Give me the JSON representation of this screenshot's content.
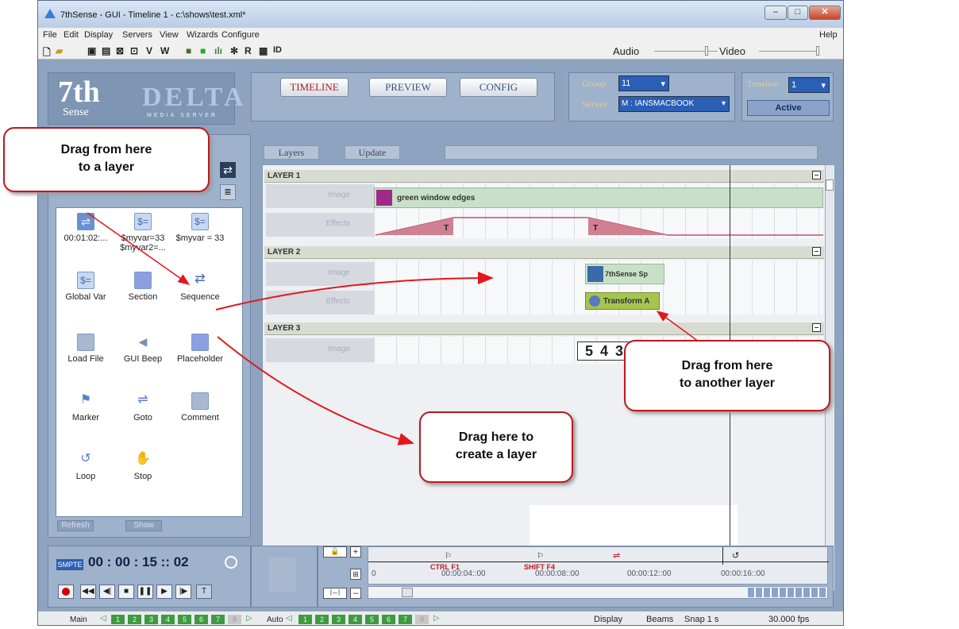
{
  "window": {
    "title": "7thSense -  GUI - Timeline 1 - c:\\shows\\test.xml*"
  },
  "menu": {
    "items": [
      "File",
      "Edit",
      "Display",
      "Servers",
      "View",
      "Wizards",
      "Configure"
    ],
    "help": "Help"
  },
  "toolbar": {
    "v": "V",
    "w": "W",
    "r": "R",
    "id": "ID",
    "audio": "Audio",
    "video": "Video"
  },
  "logo": {
    "brand": "7th",
    "brand_sub": "Sense",
    "product": "DELTA",
    "product_sub": "MEDIA SERVER"
  },
  "tabs": {
    "timeline": "TIMELINE",
    "preview": "PREVIEW",
    "config": "CONFIG"
  },
  "group": {
    "label": "Group",
    "value": "11"
  },
  "server": {
    "label": "Server",
    "value": "M : IANSMACBOOK"
  },
  "timeline_sel": {
    "label": "Timeline",
    "value": "1",
    "status": "Active"
  },
  "layers_bar": {
    "layers": "Layers",
    "update": "Update"
  },
  "palette": {
    "items": [
      {
        "label": "00:01:02:...",
        "icon": "goto-arrow-icon"
      },
      {
        "label": "$myvar=33\n$myvar2=...",
        "icon": "var-icon"
      },
      {
        "label": "$myvar = 33",
        "icon": "var-icon"
      },
      {
        "label": "Global Var",
        "icon": "var-icon"
      },
      {
        "label": "Section",
        "icon": "section-icon"
      },
      {
        "label": "Sequence",
        "icon": "sequence-icon"
      },
      {
        "label": "Load File",
        "icon": "floppy-icon"
      },
      {
        "label": "GUI Beep",
        "icon": "speaker-icon"
      },
      {
        "label": "Placeholder",
        "icon": "placeholder-icon"
      },
      {
        "label": "Marker",
        "icon": "flag-icon"
      },
      {
        "label": "Goto",
        "icon": "goto-icon"
      },
      {
        "label": "Comment",
        "icon": "comment-icon"
      },
      {
        "label": "Loop",
        "icon": "loop-icon"
      },
      {
        "label": "Stop",
        "icon": "stop-hand-icon"
      }
    ],
    "refresh": "Refresh",
    "show": "Show"
  },
  "layers": [
    {
      "name": "LAYER 1",
      "image_label": "Image",
      "effects_label": "Effects",
      "clip": "green window edges",
      "effect_mark": "T"
    },
    {
      "name": "LAYER 2",
      "image_label": "Image",
      "effects_label": "Effects",
      "clip": "7thSense Sp",
      "effect": "Transform A"
    },
    {
      "name": "LAYER 3",
      "image_label": "Image",
      "countdown": "5 4 3"
    }
  ],
  "transport": {
    "smpte": "SMPTE",
    "timecode": "00 : 00 : 15 :: 02"
  },
  "ruler": {
    "ticks": [
      "0",
      "00:00:04::00",
      "00:00:08::00",
      "00:00:12::00",
      "00:00:16::00"
    ],
    "cue1": "CTRL F1",
    "cue2": "SHIFT F4"
  },
  "status": {
    "main": "Main",
    "auto": "Auto",
    "display": "Display",
    "beams": "Beams",
    "snap": "Snap 1 s",
    "fps": "30.000 fps",
    "cells": [
      "1",
      "2",
      "3",
      "4",
      "5",
      "6",
      "7",
      "8"
    ]
  },
  "callouts": {
    "c1": "Drag from here\nto a layer",
    "c2": "Drag from here\nto another layer",
    "c3": "Drag here to\ncreate a layer"
  },
  "colors": {
    "accent_red": "#c0171d",
    "layer_green": "#c8e0c8",
    "effect_pink": "#d08090",
    "transform_green": "#a6c450"
  }
}
